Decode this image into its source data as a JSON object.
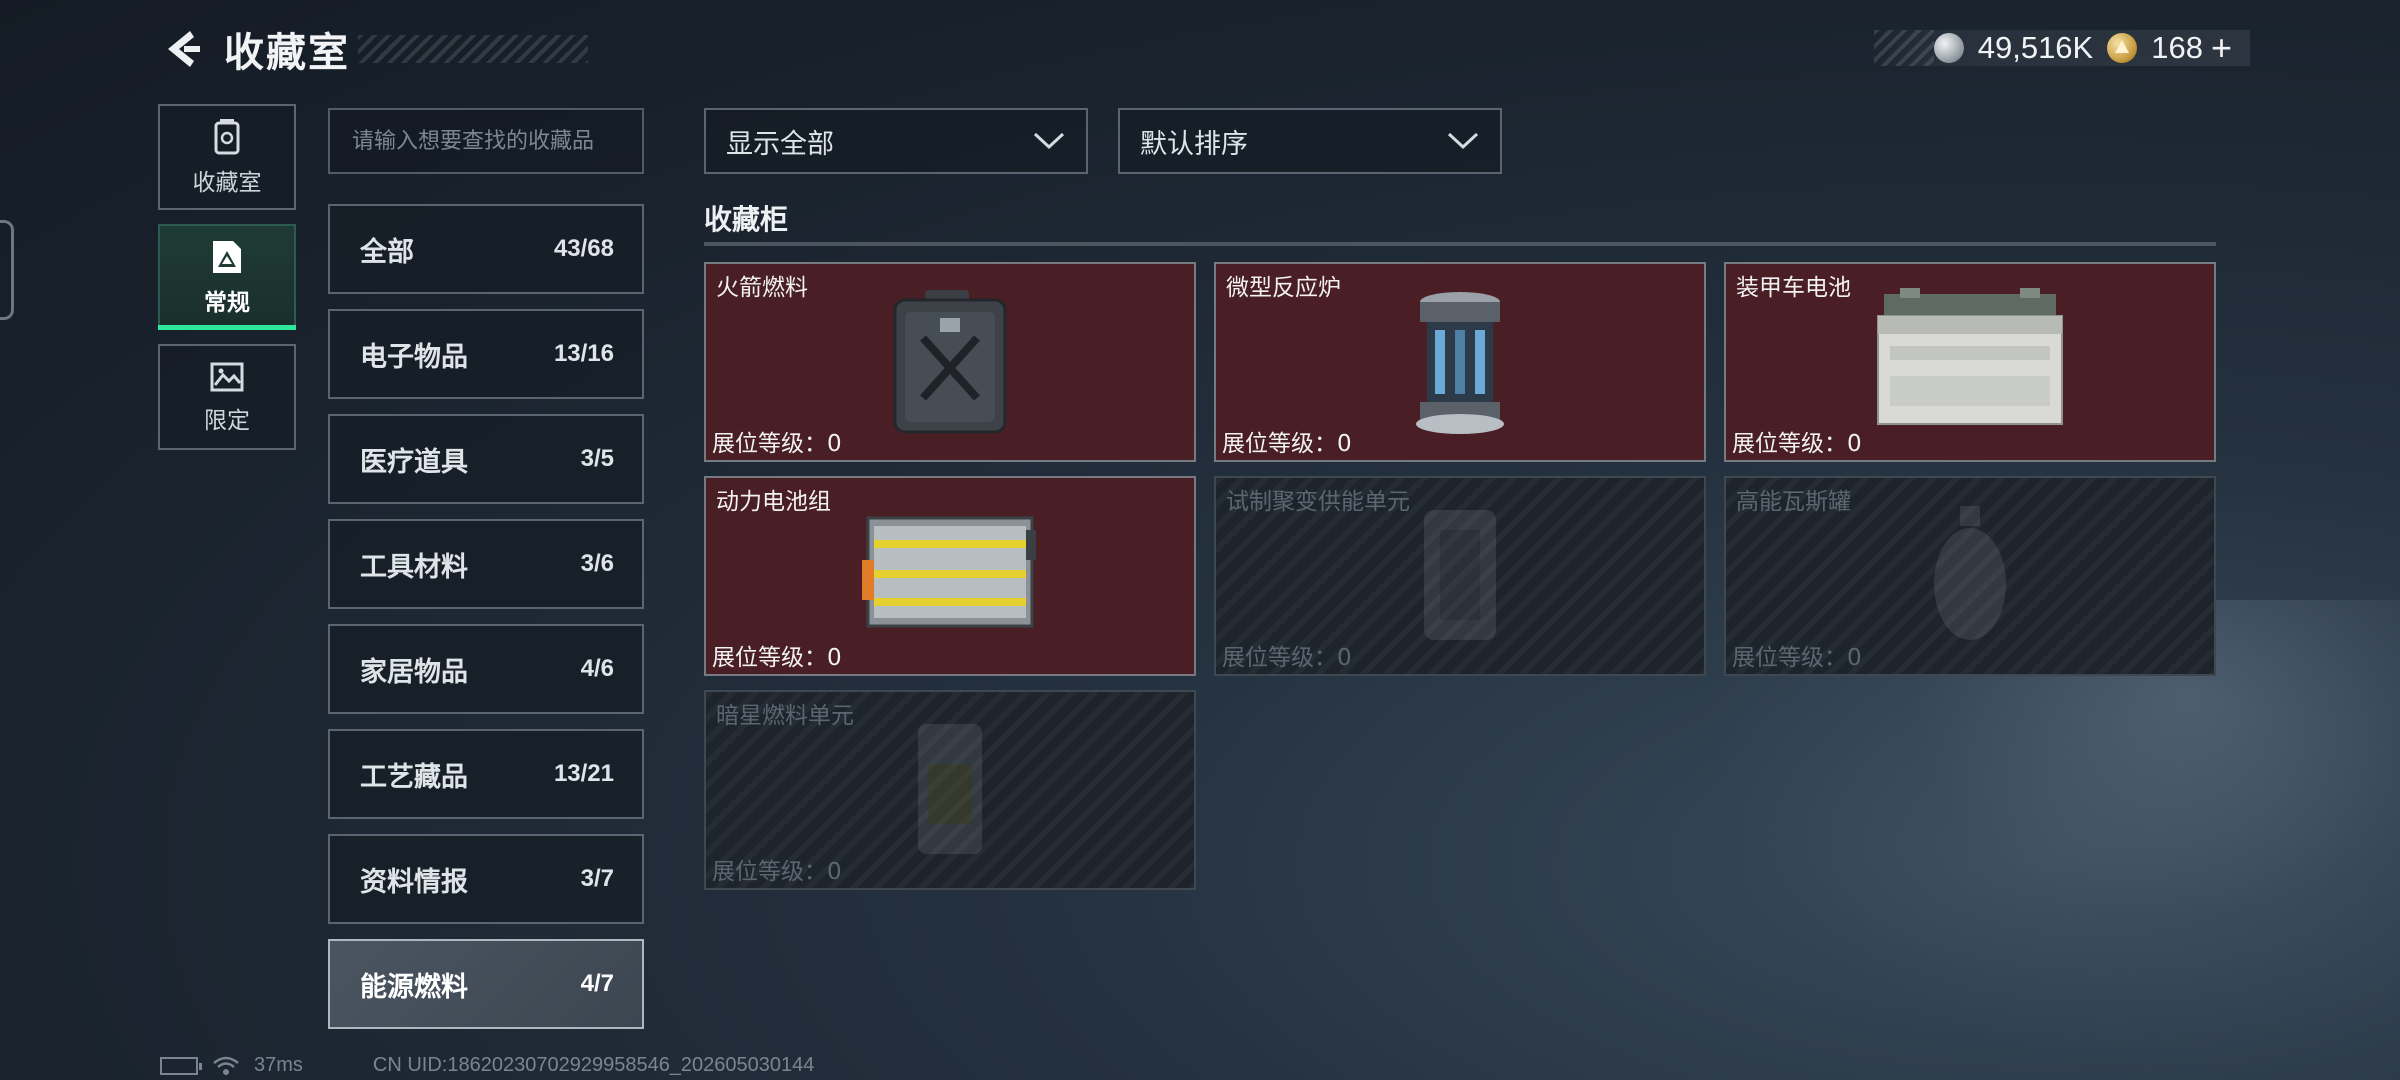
{
  "header": {
    "title": "收藏室"
  },
  "currency": {
    "silver_value": "49,516K",
    "gold_value": "168",
    "plus_label": "+"
  },
  "nav": {
    "items": [
      {
        "label": "收藏室",
        "icon": "trash-bin-icon",
        "active": false
      },
      {
        "label": "常规",
        "icon": "document-icon",
        "active": true
      },
      {
        "label": "限定",
        "icon": "picture-icon",
        "active": false
      }
    ]
  },
  "search": {
    "placeholder": "请输入想要查找的收藏品"
  },
  "categories": [
    {
      "name": "全部",
      "count": "43/68"
    },
    {
      "name": "电子物品",
      "count": "13/16"
    },
    {
      "name": "医疗道具",
      "count": "3/5"
    },
    {
      "name": "工具材料",
      "count": "3/6"
    },
    {
      "name": "家居物品",
      "count": "4/6"
    },
    {
      "name": "工艺藏品",
      "count": "13/21"
    },
    {
      "name": "资料情报",
      "count": "3/7"
    },
    {
      "name": "能源燃料",
      "count": "4/7",
      "active": true
    }
  ],
  "filters": {
    "show": "显示全部",
    "sort": "默认排序"
  },
  "section": {
    "title": "收藏柜"
  },
  "items": [
    {
      "name": "火箭燃料",
      "level": "展位等级：0",
      "owned": true,
      "icon": "jerrycan-icon"
    },
    {
      "name": "微型反应炉",
      "level": "展位等级：0",
      "owned": true,
      "icon": "reactor-icon"
    },
    {
      "name": "装甲车电池",
      "level": "展位等级：0",
      "owned": true,
      "icon": "car-battery-icon"
    },
    {
      "name": "动力电池组",
      "level": "展位等级：0",
      "owned": true,
      "icon": "battery-pack-icon"
    },
    {
      "name": "试制聚变供能单元",
      "level": "展位等级：0",
      "owned": false,
      "icon": "fusion-cell-icon"
    },
    {
      "name": "高能瓦斯罐",
      "level": "展位等级：0",
      "owned": false,
      "icon": "gas-tank-icon"
    },
    {
      "name": "暗星燃料单元",
      "level": "展位等级：0",
      "owned": false,
      "icon": "fuel-cell-icon"
    }
  ],
  "status": {
    "ping": "37ms",
    "uid": "CN UID:1862023070292995854​6_202605030144"
  },
  "colors": {
    "accent": "#2ee89a",
    "owned_card": "#4a1e25",
    "locked_card": "#1d242c"
  }
}
